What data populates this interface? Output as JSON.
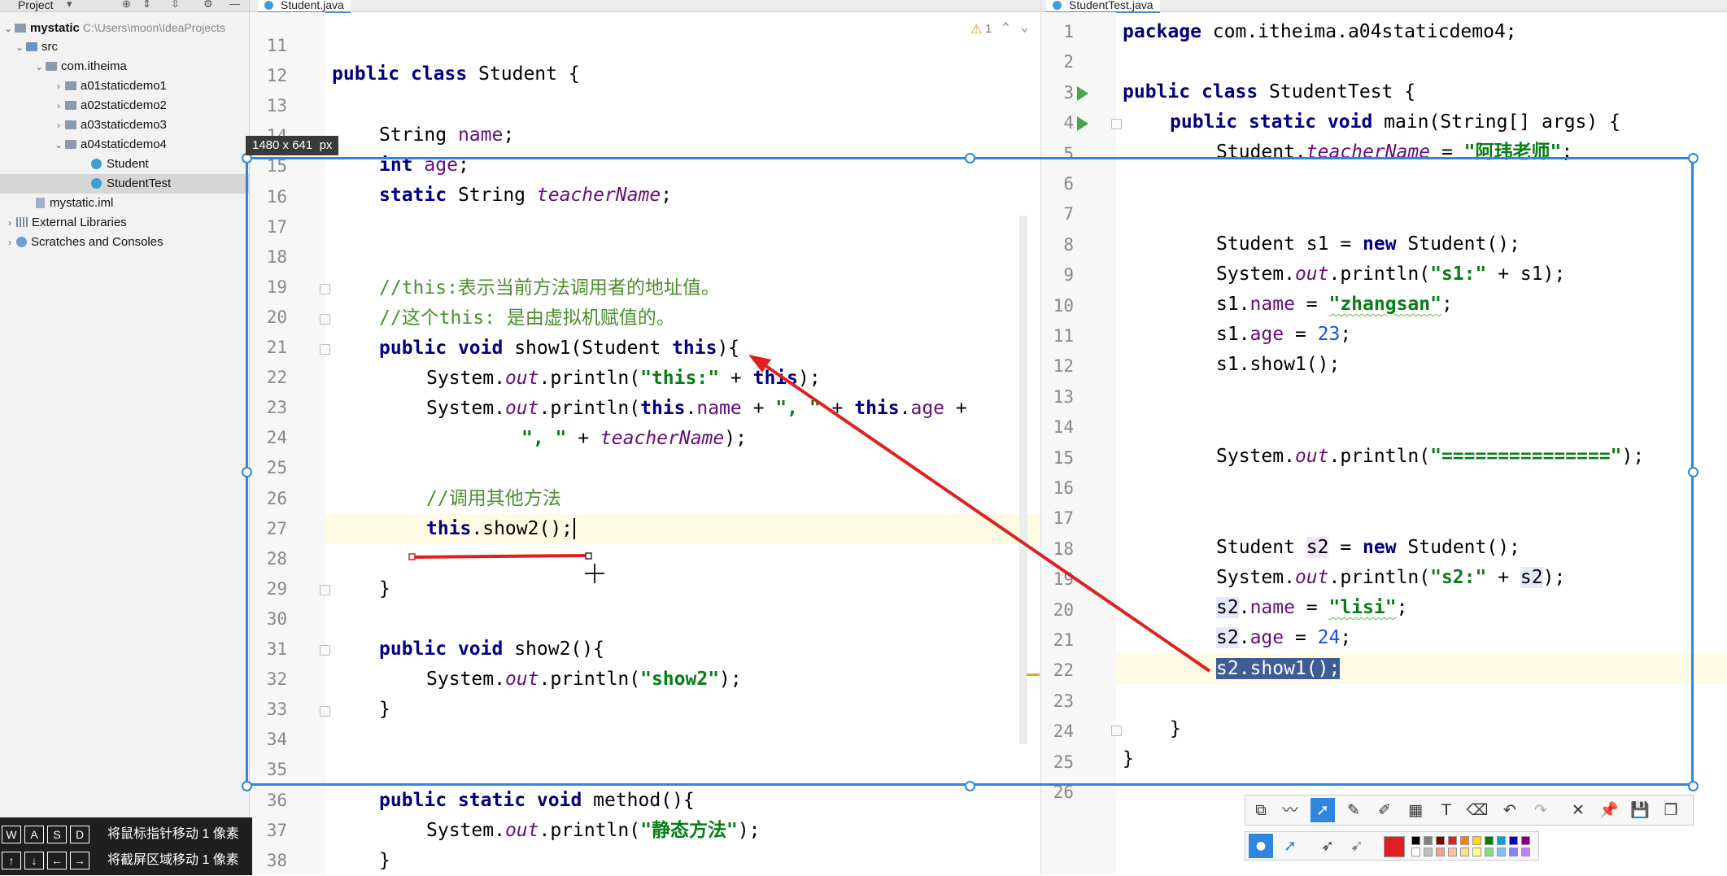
{
  "project_panel": {
    "title": "Project",
    "tree": [
      {
        "label": "mystatic",
        "path": "C:\\Users\\moon\\IdeaProjects",
        "type": "module"
      },
      {
        "label": "src",
        "type": "folder"
      },
      {
        "label": "com.itheima",
        "type": "package"
      },
      {
        "label": "a01staticdemo1",
        "type": "package"
      },
      {
        "label": "a02staticdemo2",
        "type": "package"
      },
      {
        "label": "a03staticdemo3",
        "type": "package"
      },
      {
        "label": "a04staticdemo4",
        "type": "package"
      },
      {
        "label": "Student",
        "type": "class"
      },
      {
        "label": "StudentTest",
        "type": "class",
        "selected": true
      },
      {
        "label": "mystatic.iml",
        "type": "file"
      },
      {
        "label": "External Libraries",
        "type": "library"
      },
      {
        "label": "Scratches and Consoles",
        "type": "scratch"
      }
    ]
  },
  "left_editor": {
    "tab": "Student.java",
    "warning_count": "1",
    "line_numbers": [
      "11",
      "12",
      "13",
      "14",
      "15",
      "16",
      "17",
      "18",
      "19",
      "20",
      "21",
      "22",
      "23",
      "24",
      "25",
      "26",
      "27",
      "28",
      "29",
      "30",
      "31",
      "32",
      "33",
      "34",
      "35",
      "36",
      "37",
      "38"
    ],
    "code": {
      "l12": {
        "k1": "public",
        "k2": "class",
        "t": " Student {"
      },
      "l14": {
        "t1": "String ",
        "f": "name",
        "t2": ";"
      },
      "l15": {
        "k": "int",
        "t1": " ",
        "f": "age",
        "t2": ";"
      },
      "l16": {
        "k": "static",
        "t1": " String ",
        "f": "teacherName",
        "t2": ";"
      },
      "l19": {
        "c": "//this:表示当前方法调用者的地址值。"
      },
      "l20": {
        "c": "//这个this: 是由虚拟机赋值的。"
      },
      "l21": {
        "k1": "public",
        "k2": "void",
        "t1": " show1(Student ",
        "k3": "this",
        "t2": "){"
      },
      "l22": {
        "t1": "System.",
        "f": "out",
        "t2": ".println(",
        "s": "\"this:\"",
        "t3": " + ",
        "k": "this",
        "t4": ");"
      },
      "l23": {
        "t1": "System.",
        "f": "out",
        "t2": ".println(",
        "k1": "this",
        "t3": ".",
        "f2": "name",
        "t4": " + ",
        "s": "\", \"",
        "t5": " + ",
        "k2": "this",
        "t6": ".",
        "f3": "age",
        "t7": " +"
      },
      "l24": {
        "s": "\", \"",
        "t1": " + ",
        "f": "teacherName",
        "t2": ");"
      },
      "l26": {
        "c": "//调用其他方法"
      },
      "l27": {
        "k": "this",
        "t": ".show2();"
      },
      "l29": {
        "t": "}"
      },
      "l31": {
        "k1": "public",
        "k2": "void",
        "t": " show2(){"
      },
      "l32": {
        "t1": "System.",
        "f": "out",
        "t2": ".println(",
        "s": "\"show2\"",
        "t3": ");"
      },
      "l33": {
        "t": "}"
      },
      "l36": {
        "k1": "public",
        "k2": "static",
        "k3": "void",
        "t": " method(){"
      },
      "l37": {
        "t1": "System.",
        "f": "out",
        "t2": ".println(",
        "s": "\"静态方法\"",
        "t3": ");"
      },
      "l38": {
        "t": "}"
      }
    }
  },
  "right_editor": {
    "tab": "StudentTest.java",
    "line_numbers": [
      "1",
      "2",
      "3",
      "4",
      "5",
      "6",
      "7",
      "8",
      "9",
      "10",
      "11",
      "12",
      "13",
      "14",
      "15",
      "16",
      "17",
      "18",
      "19",
      "20",
      "21",
      "22",
      "23",
      "24",
      "25",
      "26"
    ],
    "code": {
      "l1": {
        "k": "package",
        "t": " com.itheima.a04staticdemo4;"
      },
      "l3": {
        "k1": "public",
        "k2": "class",
        "t": " StudentTest {"
      },
      "l4": {
        "k1": "public",
        "k2": "static",
        "k3": "void",
        "t": " main(String[] args) {"
      },
      "l5": {
        "t1": "Student.",
        "f": "teacherName",
        "t2": " = ",
        "s": "\"阿玮老师\"",
        "t3": ";"
      },
      "l8": {
        "t1": "Student s1 = ",
        "k": "new",
        "t2": " Student();"
      },
      "l9": {
        "t1": "System.",
        "f": "out",
        "t2": ".println(",
        "s": "\"s1:\"",
        "t3": " + s1);"
      },
      "l10": {
        "t1": "s1.",
        "f": "name",
        "t2": " = ",
        "s": "\"zhangsan\"",
        "t3": ";"
      },
      "l11": {
        "t1": "s1.",
        "f": "age",
        "t2": " = ",
        "n": "23",
        "t3": ";"
      },
      "l12": {
        "t": "s1.show1();"
      },
      "l15": {
        "t1": "System.",
        "f": "out",
        "t2": ".println(",
        "s": "\"===============\"",
        "t3": ");"
      },
      "l18": {
        "t1": "Student ",
        "v": "s2",
        "t2": " = ",
        "k": "new",
        "t3": " Student();"
      },
      "l19": {
        "t1": "System.",
        "f": "out",
        "t2": ".println(",
        "s": "\"s2:\"",
        "t3": " + ",
        "v": "s2",
        "t4": ");"
      },
      "l20": {
        "v": "s2",
        "t1": ".",
        "f": "name",
        "t2": " = ",
        "s": "\"lisi\"",
        "t3": ";"
      },
      "l21": {
        "v": "s2",
        "t1": ".",
        "f": "age",
        "t2": " = ",
        "n": "24",
        "t3": ";"
      },
      "l22": {
        "sel": "s2.show1();"
      },
      "l24": {
        "t": "}"
      },
      "l25": {
        "t": "}"
      }
    }
  },
  "capture": {
    "size_label": "1480 x 641",
    "size_unit": "px",
    "border_color": "#2e86de"
  },
  "annotations": {
    "arrow_color": "#e02020"
  },
  "shortcut_hints": [
    {
      "keys": [
        "W",
        "A",
        "S",
        "D"
      ],
      "text": "将鼠标指针移动 1 像素"
    },
    {
      "keys": [
        "↑",
        "↓",
        "←",
        "→"
      ],
      "text": "将截屏区域移动 1 像素"
    }
  ],
  "annotation_toolbar": {
    "tools": [
      "rectangle-tool-icon",
      "pencil-tool-icon",
      "arrow-tool-icon",
      "pen-tool-icon",
      "marker-tool-icon",
      "mosaic-tool-icon",
      "text-tool-icon",
      "eraser-tool-icon",
      "undo-icon",
      "redo-icon",
      "close-icon",
      "pin-icon",
      "save-icon",
      "copy-icon"
    ],
    "active_tool": "arrow-tool-icon",
    "text_tool_label": "T",
    "selected_color": "#e02020",
    "palette": [
      "#000000",
      "#808080",
      "#800000",
      "#e02020",
      "#ff8000",
      "#ffd700",
      "#008000",
      "#00a0e0",
      "#0000c0",
      "#800080",
      "#ffffff",
      "#c0c0c0",
      "#ff9999",
      "#ffc0a0",
      "#ffe080",
      "#ffff80",
      "#80e080",
      "#80c0ff",
      "#8080ff",
      "#c080ff"
    ]
  }
}
